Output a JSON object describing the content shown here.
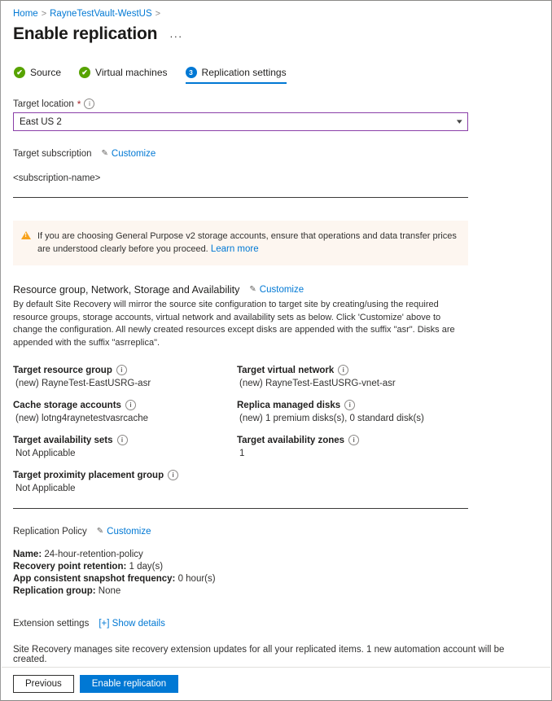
{
  "breadcrumb": {
    "home": "Home",
    "vault": "RayneTestVault-WestUS",
    "separator": ">"
  },
  "header": {
    "title": "Enable replication",
    "more_label": "···"
  },
  "tabs": [
    {
      "label": "Source",
      "state": "done",
      "badge": "✔"
    },
    {
      "label": "Virtual machines",
      "state": "done",
      "badge": "✔"
    },
    {
      "label": "Replication settings",
      "state": "active",
      "badge": "3"
    }
  ],
  "target_location": {
    "label": "Target location",
    "required_marker": "*",
    "value": "East US 2",
    "chevron": "⌵"
  },
  "target_subscription": {
    "label": "Target subscription",
    "customize_label": "Customize",
    "value": "<subscription-name>"
  },
  "warning": {
    "text": "If you are choosing General Purpose v2 storage accounts, ensure that operations and data transfer prices are understood clearly before you proceed. ",
    "link_label": "Learn more"
  },
  "resource_section": {
    "title": "Resource group, Network, Storage and Availability",
    "customize_label": "Customize",
    "description": "By default Site Recovery will mirror the source site configuration to target site by creating/using the required resource groups, storage accounts, virtual network and availability sets as below. Click 'Customize' above to change the configuration. All newly created resources except disks are appended with the suffix \"asr\". Disks are appended with the suffix \"asrreplica\".",
    "left_items": [
      {
        "label": "Target resource group",
        "value": "(new) RayneTest-EastUSRG-asr"
      },
      {
        "label": "Cache storage accounts",
        "value": "(new) lotng4raynetestvasrcache"
      },
      {
        "label": "Target availability sets",
        "value": "Not Applicable"
      },
      {
        "label": "Target proximity placement group",
        "value": "Not Applicable"
      }
    ],
    "right_items": [
      {
        "label": "Target virtual network",
        "value": "(new) RayneTest-EastUSRG-vnet-asr"
      },
      {
        "label": "Replica managed disks",
        "value": "(new) 1 premium disks(s), 0 standard disk(s)"
      },
      {
        "label": "Target availability zones",
        "value": "1"
      }
    ]
  },
  "replication_policy": {
    "title": "Replication Policy",
    "customize_label": "Customize",
    "lines": [
      {
        "label": "Name:",
        "value": "24-hour-retention-policy"
      },
      {
        "label": "Recovery point retention:",
        "value": "1 day(s)"
      },
      {
        "label": "App consistent snapshot frequency:",
        "value": "0 hour(s)"
      },
      {
        "label": "Replication group:",
        "value": "None"
      }
    ]
  },
  "extension_settings": {
    "title": "Extension settings",
    "show_details_label": "[+] Show details",
    "description": "Site Recovery manages site recovery extension updates for all your replicated items. 1 new automation account will be created."
  },
  "footer": {
    "previous_label": "Previous",
    "enable_label": "Enable replication"
  }
}
